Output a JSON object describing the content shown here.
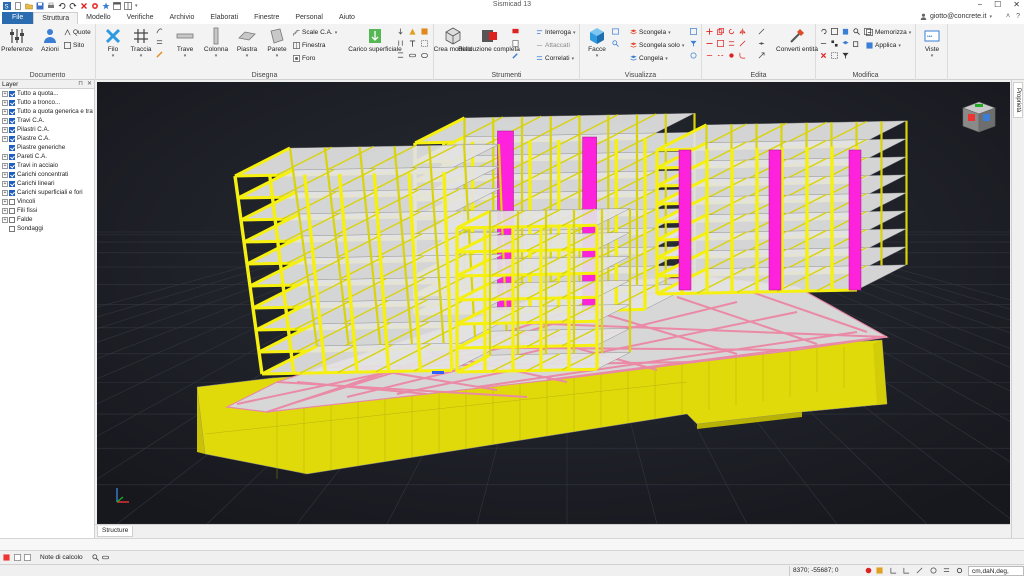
{
  "window": {
    "title": "Sismicad 13"
  },
  "tabs": [
    "File",
    "Struttura",
    "Modello",
    "Verifiche",
    "Archivio",
    "Elaborati",
    "Finestre",
    "Personal",
    "Aiuto"
  ],
  "active_tab": "Struttura",
  "user": {
    "email": "giotto@concrete.it"
  },
  "ribbon": {
    "documento": {
      "label": "Documento",
      "preferenze": "Preferenze",
      "azioni": "Azioni",
      "quote": "Quote",
      "sito": "Sito"
    },
    "disegna": {
      "label": "Disegna",
      "filo": "Filo",
      "traccia": "Traccia",
      "trave": "Trave",
      "colonna": "Colonna",
      "piastra": "Piastra",
      "parete": "Parete",
      "scale_ca": "Scale C.A.",
      "finestra": "Finestra",
      "foro": "Foro",
      "carico_superficiale": "Carico superficiale"
    },
    "strumenti": {
      "label": "Strumenti",
      "crea_modello": "Crea modello",
      "risoluzione_completa": "Risoluzione completa",
      "interroga": "Interroga",
      "attaccati": "Attaccati",
      "correlati": "Correlati"
    },
    "visualizza": {
      "label": "Visualizza",
      "facce": "Facce",
      "scongela": "Scongela",
      "scongela_solo": "Scongela solo",
      "congela": "Congela"
    },
    "edita": {
      "label": "Edita",
      "converti_entita": "Converti entità"
    },
    "modifica": {
      "label": "Modifica",
      "memorizza": "Memorizza",
      "applica": "Applica",
      "viste": "Viste"
    }
  },
  "layer_panel": {
    "title": "Layer",
    "items": [
      {
        "label": "Tutto a quota...",
        "checked": true,
        "expandable": true
      },
      {
        "label": "Tutto a tronco...",
        "checked": true,
        "expandable": true
      },
      {
        "label": "Tutto a quota generica e tra",
        "checked": true,
        "expandable": true
      },
      {
        "label": "Travi C.A.",
        "checked": true,
        "expandable": true
      },
      {
        "label": "Pilastri C.A.",
        "checked": true,
        "expandable": true
      },
      {
        "label": "Piastre C.A.",
        "checked": true,
        "expandable": true
      },
      {
        "label": "Piastre generiche",
        "checked": true,
        "expandable": false
      },
      {
        "label": "Pareti C.A.",
        "checked": true,
        "expandable": true
      },
      {
        "label": "Travi in acciaio",
        "checked": true,
        "expandable": true
      },
      {
        "label": "Carichi concentrati",
        "checked": true,
        "expandable": true
      },
      {
        "label": "Carichi lineari",
        "checked": true,
        "expandable": true
      },
      {
        "label": "Carichi superficiali e fori",
        "checked": true,
        "expandable": true
      },
      {
        "label": "Vincoli",
        "checked": false,
        "expandable": true
      },
      {
        "label": "Fili fissi",
        "checked": false,
        "expandable": true
      },
      {
        "label": "Falde",
        "checked": false,
        "expandable": true
      },
      {
        "label": "Sondaggi",
        "checked": false,
        "expandable": false
      }
    ]
  },
  "viewport": {
    "tab": "Structure"
  },
  "properties_tab": "Proprietà",
  "bottom": {
    "notes_label": "Note di calcolo"
  },
  "status": {
    "coords": "8370; -55687; 0",
    "units": "cm,daN,deg,°C,s"
  },
  "colors": {
    "accent": "#2b6cb0",
    "viewport_bg": "#1e2027",
    "wall": "#f5f010",
    "column": "#ff22dd",
    "slab": "#e4e4e4",
    "foundation_beam": "#f08aa8"
  }
}
